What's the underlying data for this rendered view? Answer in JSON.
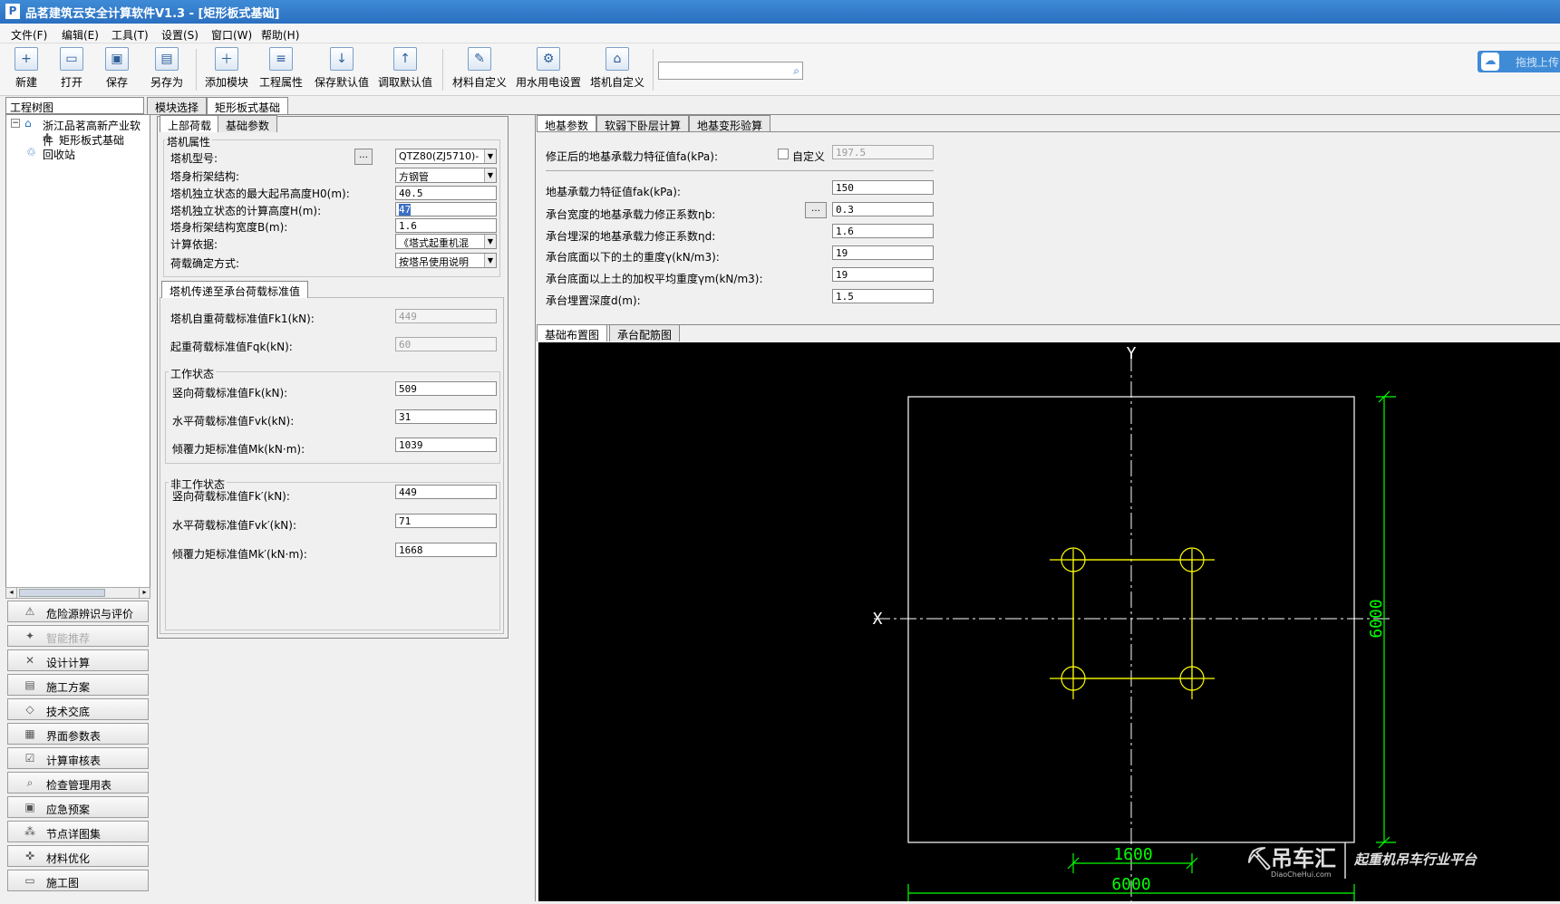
{
  "title": "品茗建筑云安全计算软件V1.3 - [矩形板式基础]",
  "app_logo": "P",
  "menu": [
    "文件(F)",
    "编辑(E)",
    "工具(T)",
    "设置(S)",
    "窗口(W)",
    "帮助(H)"
  ],
  "toolbar": {
    "new": "新建",
    "open": "打开",
    "save": "保存",
    "save_as": "另存为",
    "add_module": "添加模块",
    "project_props": "工程属性",
    "save_default": "保存默认值",
    "load_default": "调取默认值",
    "material_custom": "材料自定义",
    "water_power": "用水用电设置",
    "crane_custom": "塔机自定义"
  },
  "upload_label": "拖拽上传",
  "left": {
    "header": "工程树图",
    "tree_root": "浙江品茗高新产业软件",
    "tree_child": "矩形板式基础",
    "tree_recycle": "回收站",
    "side_buttons": [
      {
        "label": "危险源辨识与评价",
        "icon": "warning-icon"
      },
      {
        "label": "智能推荐",
        "icon": "lightbulb-icon"
      },
      {
        "label": "设计计算",
        "icon": "tools-icon"
      },
      {
        "label": "施工方案",
        "icon": "document-icon"
      },
      {
        "label": "技术交底",
        "icon": "code-icon"
      },
      {
        "label": "界面参数表",
        "icon": "table-icon"
      },
      {
        "label": "计算审核表",
        "icon": "checklist-icon"
      },
      {
        "label": "检查管理用表",
        "icon": "inspect-icon"
      },
      {
        "label": "应急预案",
        "icon": "emergency-icon"
      },
      {
        "label": "节点详图集",
        "icon": "nodes-icon"
      },
      {
        "label": "材料优化",
        "icon": "material-icon"
      },
      {
        "label": "施工图",
        "icon": "drawing-icon"
      }
    ]
  },
  "mid_tabs": {
    "module_select": "模块选择",
    "rect_base": "矩形板式基础"
  },
  "load_tabs": {
    "upper": "上部荷载",
    "base_params": "基础参数"
  },
  "crane": {
    "group": "塔机属性",
    "model_label": "塔机型号:",
    "model_value": "QTZ80(ZJ5710)-",
    "frame_label": "塔身桁架结构:",
    "frame_value": "方钢管",
    "max_height_label": "塔机独立状态的最大起吊高度H0(m):",
    "max_height_value": "40.5",
    "calc_height_label": "塔机独立状态的计算高度H(m):",
    "calc_height_value": "47",
    "width_label": "塔身桁架结构宽度B(m):",
    "width_value": "1.6",
    "basis_label": "计算依据:",
    "basis_value": "《塔式起重机混",
    "load_mode_label": "荷载确定方式:",
    "load_mode_value": "按塔吊使用说明"
  },
  "transfer": {
    "tab": "塔机传递至承台荷载标准值",
    "self_weight_label": "塔机自重荷载标准值Fk1(kN):",
    "self_weight_value": "449",
    "lift_label": "起重荷载标准值Fqk(kN):",
    "lift_value": "60",
    "work_group": "工作状态",
    "v_label": "竖向荷载标准值Fk(kN):",
    "v_value": "509",
    "h_label": "水平荷载标准值Fvk(kN):",
    "h_value": "31",
    "m_label": "倾覆力矩标准值Mk(kN·m):",
    "m_value": "1039",
    "nonwork_group": "非工作状态",
    "nv_label": "竖向荷载标准值Fk′(kN):",
    "nv_value": "449",
    "nh_label": "水平荷载标准值Fvk′(kN):",
    "nh_value": "71",
    "nm_label": "倾覆力矩标准值Mk′(kN·m):",
    "nm_value": "1668"
  },
  "right_tabs": {
    "ground": "地基参数",
    "weak": "软弱下卧层计算",
    "deform": "地基变形验算"
  },
  "ground": {
    "fa_label": "修正后的地基承载力特征值fa(kPa):",
    "custom_label": "自定义",
    "fa_value": "197.5",
    "fak_label": "地基承载力特征值fak(kPa):",
    "fak_value": "150",
    "eta_b_label": "承台宽度的地基承载力修正系数ηb:",
    "eta_b_value": "0.3",
    "eta_d_label": "承台埋深的地基承载力修正系数ηd:",
    "eta_d_value": "1.6",
    "gamma_label": "承台底面以下的土的重度γ(kN/m3):",
    "gamma_value": "19",
    "gamma_m_label": "承台底面以上土的加权平均重度γm(kN/m3):",
    "gamma_m_value": "19",
    "depth_label": "承台埋置深度d(m):",
    "depth_value": "1.5"
  },
  "drawing_tabs": {
    "layout": "基础布置图",
    "rebar": "承台配筋图"
  },
  "drawing": {
    "axis_y": "Y",
    "axis_x": "X",
    "dim_vertical": "6000",
    "dim_inner": "1600",
    "dim_bottom": "6000"
  },
  "watermark": {
    "brand": "吊车汇",
    "url": "DiaoCheHui.com",
    "slogan": "起重机吊车行业平台"
  },
  "colors": {
    "accent": "#2a6fc0",
    "canvas_bg": "#000000",
    "cad_yellow": "#ffff00",
    "cad_green": "#00ff00"
  }
}
